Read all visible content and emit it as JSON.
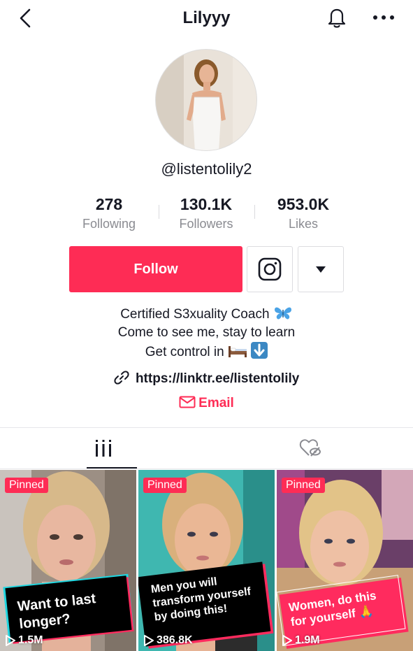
{
  "header": {
    "title": "Lilyyy",
    "back_icon": "chevron-left-icon",
    "bell_icon": "bell-icon",
    "more_icon": "more-horizontal-icon"
  },
  "profile": {
    "username": "@listentolily2"
  },
  "stats": [
    {
      "value": "278",
      "label": "Following"
    },
    {
      "value": "130.1K",
      "label": "Followers"
    },
    {
      "value": "953.0K",
      "label": "Likes"
    }
  ],
  "actions": {
    "follow_label": "Follow",
    "instagram_icon": "instagram-icon",
    "dropdown_icon": "caret-down-icon"
  },
  "bio": {
    "line1": "Certified S3xuality Coach",
    "line2": "Come to see me, stay to learn",
    "line3": "Get control in",
    "link": "https://linktr.ee/listentolily",
    "email_label": "Email"
  },
  "tabs": [
    {
      "icon": "videos-grid-icon",
      "active": true
    },
    {
      "icon": "liked-hidden-icon",
      "active": false
    }
  ],
  "videos": [
    {
      "pinned": "Pinned",
      "caption": "Want to last longer?",
      "views": "1.5M"
    },
    {
      "pinned": "Pinned",
      "caption": "Men you will transform yourself by doing this!",
      "views": "386.8K"
    },
    {
      "pinned": "Pinned",
      "caption": "Women, do this for yourself 🙏",
      "views": "1.9M"
    }
  ],
  "colors": {
    "accent": "#fe2c55",
    "text": "#161823",
    "secondary_text": "#8a8b91"
  }
}
